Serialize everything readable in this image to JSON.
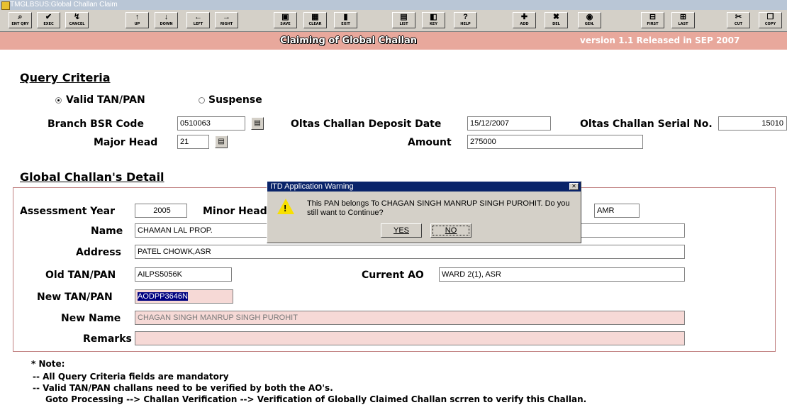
{
  "window": {
    "title": "TMGLBSUS:Global Challan Claim"
  },
  "toolbar": [
    {
      "label": "ENT QRY",
      "icon": "query-icon",
      "glyph": "⌕"
    },
    {
      "label": "EXEC",
      "icon": "execute-icon",
      "glyph": "✔"
    },
    {
      "label": "CANCEL",
      "icon": "cancel-icon",
      "glyph": "↯"
    },
    {
      "label": "UP",
      "icon": "up-arrow-icon",
      "glyph": "↑"
    },
    {
      "label": "DOWN",
      "icon": "down-arrow-icon",
      "glyph": "↓"
    },
    {
      "label": "LEFT",
      "icon": "left-arrow-icon",
      "glyph": "←"
    },
    {
      "label": "RIGHT",
      "icon": "right-arrow-icon",
      "glyph": "→"
    },
    {
      "label": "SAVE",
      "icon": "save-icon",
      "glyph": "▣"
    },
    {
      "label": "CLEAR",
      "icon": "clear-icon",
      "glyph": "▦"
    },
    {
      "label": "EXIT",
      "icon": "exit-icon",
      "glyph": "▮"
    },
    {
      "label": "LIST",
      "icon": "list-icon",
      "glyph": "▤"
    },
    {
      "label": "KEY",
      "icon": "key-icon",
      "glyph": "◧"
    },
    {
      "label": "HELP",
      "icon": "help-icon",
      "glyph": "?"
    },
    {
      "label": "ADD",
      "icon": "add-icon",
      "glyph": "✚"
    },
    {
      "label": "DEL",
      "icon": "delete-icon",
      "glyph": "✖"
    },
    {
      "label": "GEN.",
      "icon": "generate-icon",
      "glyph": "◉"
    },
    {
      "label": "FIRST",
      "icon": "first-icon",
      "glyph": "⊟"
    },
    {
      "label": "LAST",
      "icon": "last-icon",
      "glyph": "⊞"
    },
    {
      "label": "CUT",
      "icon": "cut-icon",
      "glyph": "✂"
    },
    {
      "label": "COPY",
      "icon": "copy-icon",
      "glyph": "❐"
    }
  ],
  "header": {
    "title": "Claiming of Global Challan",
    "version": "version 1.1  Released in SEP 2007"
  },
  "query": {
    "heading": "Query Criteria",
    "radio_valid": "Valid TAN/PAN",
    "radio_suspense": "Suspense",
    "bsr_label": "Branch BSR Code",
    "bsr_value": "0510063",
    "date_label": "Oltas Challan Deposit Date",
    "date_value": "15/12/2007",
    "serial_label": "Oltas Challan Serial No.",
    "serial_value": "15010",
    "major_label": "Major Head",
    "major_value": "21",
    "amount_label": "Amount",
    "amount_value": "275000"
  },
  "detail": {
    "heading": "Global Challan's Detail",
    "ay_label": "Assessment Year",
    "ay_value": "2005",
    "minor_label": "Minor Head",
    "city_value": "AMR",
    "name_label": "Name",
    "name_value": "CHAMAN LAL PROP.",
    "address_label": "Address",
    "address_value": "PATEL CHOWK,ASR",
    "oldpan_label": "Old TAN/PAN",
    "oldpan_value": "AILPS5056K",
    "ao_label": "Current AO",
    "ao_value": "WARD 2(1), ASR",
    "newpan_label": "New TAN/PAN",
    "newpan_value": "AODPP3646N",
    "newname_label": "New Name",
    "newname_value": "CHAGAN SINGH MANRUP SINGH PUROHIT",
    "remarks_label": "Remarks",
    "remarks_value": ""
  },
  "dialog": {
    "title": "ITD Application Warning",
    "message": "This PAN belongs To CHAGAN SINGH MANRUP SINGH PUROHIT. Do you still want to Continue?",
    "yes": "YES",
    "no": "NO"
  },
  "notes": {
    "title": "* Note:",
    "line1": "-- All Query Criteria fields are mandatory",
    "line2": "-- Valid TAN/PAN challans need to be verified by both the AO's.",
    "line3": "Goto Processing --> Challan Verification --> Verification of Globally Claimed Challan scrren to verify this Challan."
  },
  "colors": {
    "band": "#e8a89c",
    "dialog_title": "#0a246a",
    "pink_field": "#f6d9d6"
  }
}
